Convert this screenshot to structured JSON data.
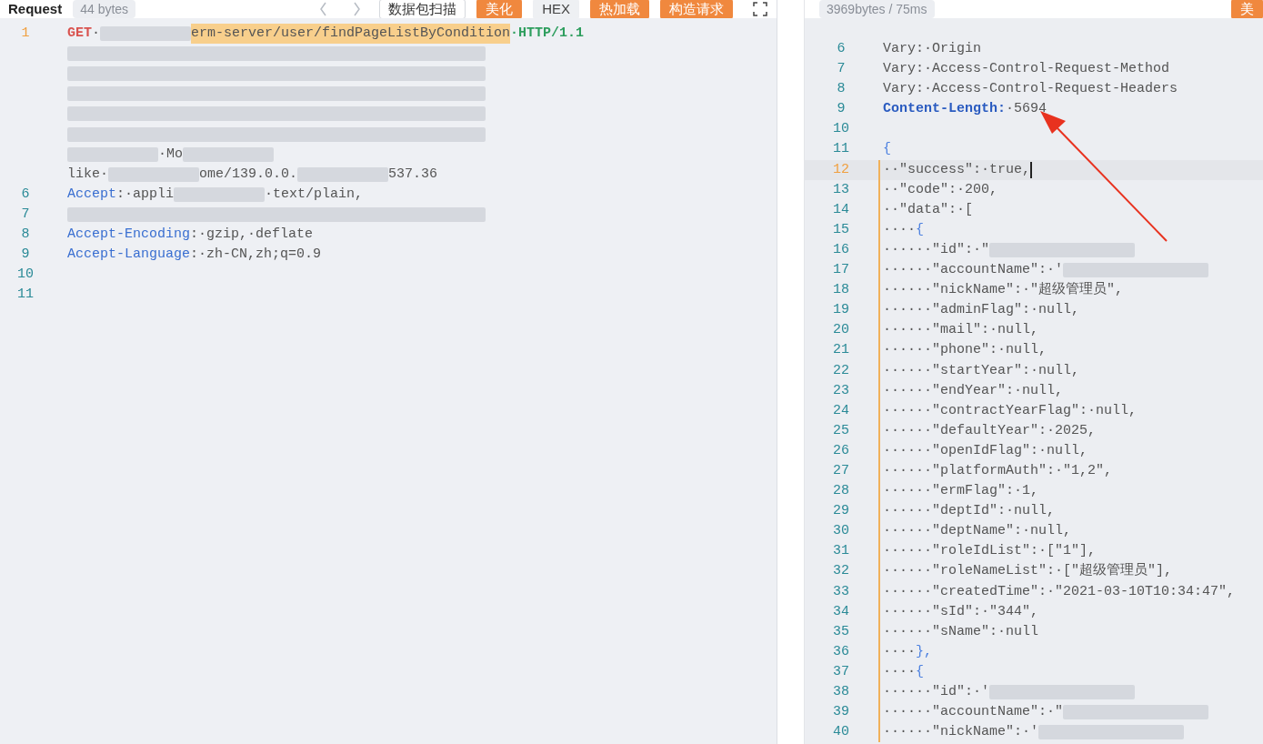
{
  "request": {
    "title": "Request",
    "size": "44 bytes",
    "toolbar": [
      {
        "label": "数据包扫描",
        "kind": "outline"
      },
      {
        "label": "美化",
        "kind": "accent"
      },
      {
        "label": "HEX",
        "kind": "plain"
      },
      {
        "label": "热加载",
        "kind": "accent"
      },
      {
        "label": "构造请求",
        "kind": "accent"
      }
    ],
    "lines": [
      {
        "number": "1",
        "current": true,
        "parts": [
          {
            "kind": "method",
            "text": "GET"
          },
          {
            "kind": "plain",
            "text": "·"
          },
          {
            "kind": "redacted"
          },
          {
            "kind": "path",
            "text": "erm-server/user/findPageListByCondition"
          },
          {
            "kind": "version",
            "text": "·HTTP/1.1"
          }
        ]
      },
      {
        "parts": [
          {
            "kind": "redacted"
          }
        ]
      },
      {
        "parts": [
          {
            "kind": "redacted"
          }
        ]
      },
      {
        "parts": [
          {
            "kind": "redacted"
          }
        ]
      },
      {
        "parts": [
          {
            "kind": "redacted"
          }
        ]
      },
      {
        "parts": [
          {
            "kind": "redacted"
          }
        ]
      },
      {
        "parts": [
          {
            "kind": "redacted"
          },
          {
            "kind": "plain",
            "text": "·Mo"
          },
          {
            "kind": "redacted"
          }
        ]
      },
      {
        "parts": [
          {
            "kind": "plain",
            "text": "like·"
          },
          {
            "kind": "redacted"
          },
          {
            "kind": "plain",
            "text": "ome/139.0.0."
          },
          {
            "kind": "redacted"
          },
          {
            "kind": "plain",
            "text": "537.36"
          }
        ]
      },
      {
        "number": "6",
        "current": false,
        "parts": [
          {
            "kind": "key",
            "text": "Accept"
          },
          {
            "kind": "plain",
            "text": ":·appli"
          },
          {
            "kind": "redacted"
          },
          {
            "kind": "plain",
            "text": "·text/plain,"
          }
        ]
      },
      {
        "number": "7",
        "current": false,
        "parts": [
          {
            "kind": "redacted"
          }
        ]
      },
      {
        "number": "8",
        "current": false,
        "parts": [
          {
            "kind": "key",
            "text": "Accept-Encoding"
          },
          {
            "kind": "plain",
            "text": ":·gzip,·deflate"
          }
        ]
      },
      {
        "number": "9",
        "current": false,
        "parts": [
          {
            "kind": "key",
            "text": "Accept-Language"
          },
          {
            "kind": "plain",
            "text": ":·zh-CN,zh;q=0.9"
          }
        ]
      },
      {
        "number": "10",
        "current": false
      },
      {
        "number": "11",
        "current": false
      }
    ]
  },
  "response": {
    "size": "3969bytes / 75ms",
    "toolbar": [
      {
        "label": "美",
        "kind": "accent"
      }
    ],
    "lines": [
      {
        "number": "6",
        "current": false,
        "guide": false,
        "parts": [
          {
            "kind": "plain",
            "text": "Vary:·Origin"
          }
        ]
      },
      {
        "number": "7",
        "current": false,
        "guide": false,
        "parts": [
          {
            "kind": "plain",
            "text": "Vary:·Access-Control-Request-Method"
          }
        ]
      },
      {
        "number": "8",
        "current": false,
        "guide": false,
        "parts": [
          {
            "kind": "plain",
            "text": "Vary:·Access-Control-Request-Headers"
          }
        ]
      },
      {
        "number": "9",
        "current": false,
        "guide": false,
        "parts": [
          {
            "kind": "strongkey",
            "text": "Content-Length:"
          },
          {
            "kind": "plain",
            "text": "·5694"
          }
        ]
      },
      {
        "number": "10",
        "current": false,
        "guide": false
      },
      {
        "number": "11",
        "current": false,
        "guide": false,
        "parts": [
          {
            "kind": "brace",
            "text": "{"
          }
        ]
      },
      {
        "number": "12",
        "current": true,
        "guide": true,
        "parts": [
          {
            "kind": "plain",
            "text": "··\"success\":·true,"
          }
        ]
      },
      {
        "number": "13",
        "current": false,
        "guide": true,
        "parts": [
          {
            "kind": "plain",
            "text": "··\"code\":·200,"
          }
        ]
      },
      {
        "number": "14",
        "current": false,
        "guide": true,
        "parts": [
          {
            "kind": "plain",
            "text": "··\"data\":·["
          }
        ]
      },
      {
        "number": "15",
        "current": false,
        "guide": true,
        "parts": [
          {
            "kind": "plain",
            "text": "····"
          },
          {
            "kind": "brace",
            "text": "{"
          }
        ]
      },
      {
        "number": "16",
        "current": false,
        "guide": true,
        "parts": [
          {
            "kind": "plain",
            "text": "······\"id\":·\""
          },
          {
            "kind": "redacted"
          }
        ]
      },
      {
        "number": "17",
        "current": false,
        "guide": true,
        "parts": [
          {
            "kind": "plain",
            "text": "······\"accountName\":·'"
          },
          {
            "kind": "redacted"
          }
        ]
      },
      {
        "number": "18",
        "current": false,
        "guide": true,
        "parts": [
          {
            "kind": "plain",
            "text": "······\"nickName\":·\"超级管理员\","
          }
        ]
      },
      {
        "number": "19",
        "current": false,
        "guide": true,
        "parts": [
          {
            "kind": "plain",
            "text": "······\"adminFlag\":·null,"
          }
        ]
      },
      {
        "number": "20",
        "current": false,
        "guide": true,
        "parts": [
          {
            "kind": "plain",
            "text": "······\"mail\":·null,"
          }
        ]
      },
      {
        "number": "21",
        "current": false,
        "guide": true,
        "parts": [
          {
            "kind": "plain",
            "text": "······\"phone\":·null,"
          }
        ]
      },
      {
        "number": "22",
        "current": false,
        "guide": true,
        "parts": [
          {
            "kind": "plain",
            "text": "······\"startYear\":·null,"
          }
        ]
      },
      {
        "number": "23",
        "current": false,
        "guide": true,
        "parts": [
          {
            "kind": "plain",
            "text": "······\"endYear\":·null,"
          }
        ]
      },
      {
        "number": "24",
        "current": false,
        "guide": true,
        "parts": [
          {
            "kind": "plain",
            "text": "······\"contractYearFlag\":·null,"
          }
        ]
      },
      {
        "number": "25",
        "current": false,
        "guide": true,
        "parts": [
          {
            "kind": "plain",
            "text": "······\"defaultYear\":·2025,"
          }
        ]
      },
      {
        "number": "26",
        "current": false,
        "guide": true,
        "parts": [
          {
            "kind": "plain",
            "text": "······\"openIdFlag\":·null,"
          }
        ]
      },
      {
        "number": "27",
        "current": false,
        "guide": true,
        "parts": [
          {
            "kind": "plain",
            "text": "······\"platformAuth\":·\"1,2\","
          }
        ]
      },
      {
        "number": "28",
        "current": false,
        "guide": true,
        "parts": [
          {
            "kind": "plain",
            "text": "······\"ermFlag\":·1,"
          }
        ]
      },
      {
        "number": "29",
        "current": false,
        "guide": true,
        "parts": [
          {
            "kind": "plain",
            "text": "······\"deptId\":·null,"
          }
        ]
      },
      {
        "number": "30",
        "current": false,
        "guide": true,
        "parts": [
          {
            "kind": "plain",
            "text": "······\"deptName\":·null,"
          }
        ]
      },
      {
        "number": "31",
        "current": false,
        "guide": true,
        "parts": [
          {
            "kind": "plain",
            "text": "······\"roleIdList\":·[\"1\"],"
          }
        ]
      },
      {
        "number": "32",
        "current": false,
        "guide": true,
        "parts": [
          {
            "kind": "plain",
            "text": "······\"roleNameList\":·[\"超级管理员\"],"
          }
        ]
      },
      {
        "number": "33",
        "current": false,
        "guide": true,
        "parts": [
          {
            "kind": "plain",
            "text": "······\"createdTime\":·\"2021-03-10T10:34:47\","
          }
        ]
      },
      {
        "number": "34",
        "current": false,
        "guide": true,
        "parts": [
          {
            "kind": "plain",
            "text": "······\"sId\":·\"344\","
          }
        ]
      },
      {
        "number": "35",
        "current": false,
        "guide": true,
        "parts": [
          {
            "kind": "plain",
            "text": "······\"sName\":·null"
          }
        ]
      },
      {
        "number": "36",
        "current": false,
        "guide": true,
        "parts": [
          {
            "kind": "plain",
            "text": "····"
          },
          {
            "kind": "brace",
            "text": "},"
          }
        ]
      },
      {
        "number": "37",
        "current": false,
        "guide": true,
        "parts": [
          {
            "kind": "plain",
            "text": "····"
          },
          {
            "kind": "brace",
            "text": "{"
          }
        ]
      },
      {
        "number": "38",
        "current": false,
        "guide": true,
        "parts": [
          {
            "kind": "plain",
            "text": "······\"id\":·'"
          },
          {
            "kind": "redacted"
          }
        ]
      },
      {
        "number": "39",
        "current": false,
        "guide": true,
        "parts": [
          {
            "kind": "plain",
            "text": "······\"accountName\":·\""
          },
          {
            "kind": "redacted"
          }
        ]
      },
      {
        "number": "40",
        "current": false,
        "guide": true,
        "parts": [
          {
            "kind": "plain",
            "text": "······\"nickName\":·'"
          },
          {
            "kind": "redacted"
          }
        ]
      }
    ]
  }
}
